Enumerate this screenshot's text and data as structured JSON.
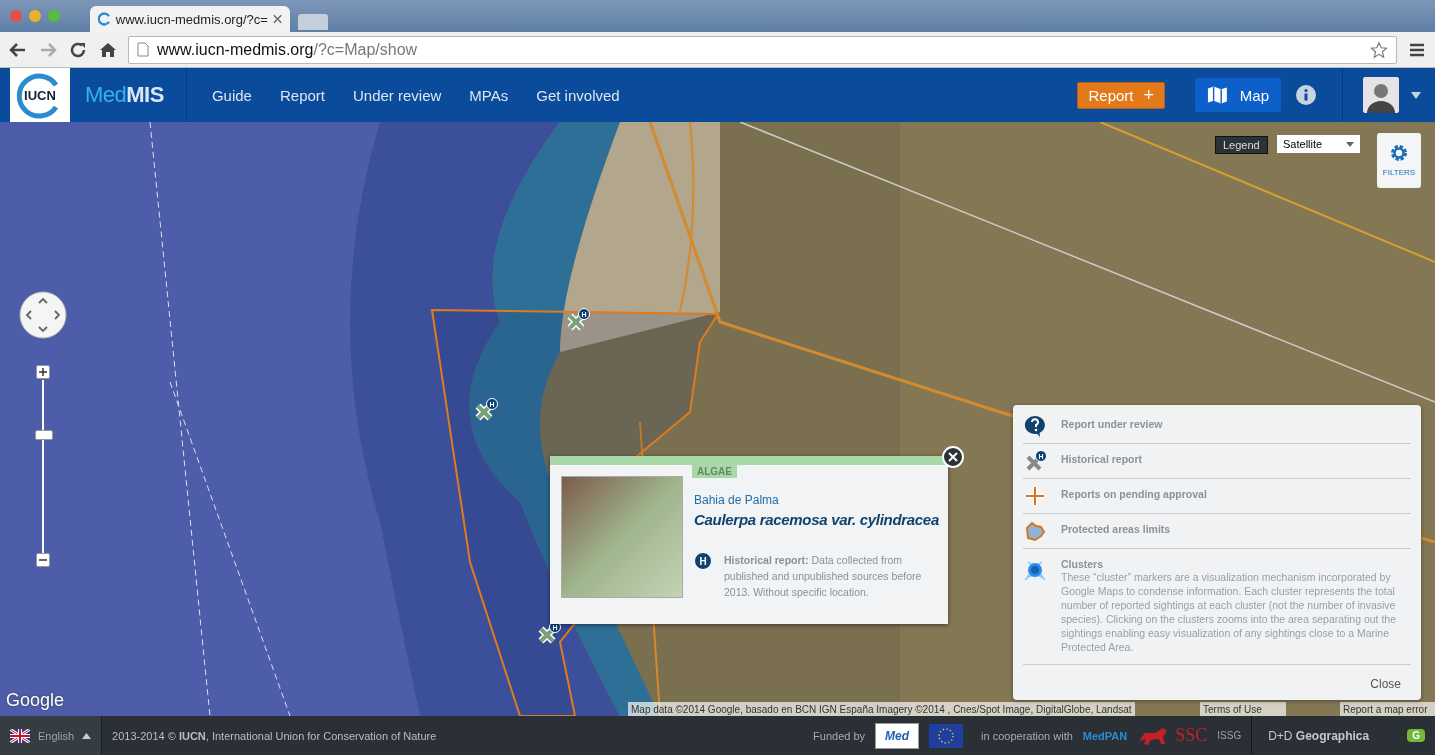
{
  "browser": {
    "tab_title": "www.iucn-medmis.org/?c=",
    "url_host": "www.iucn-medmis.org",
    "url_path": "/?c=Map/show"
  },
  "header": {
    "logo": "IUCN",
    "brand": "Med**MIS**",
    "nav": [
      {
        "label": "Guide"
      },
      {
        "label": "Report"
      },
      {
        "label": "Under review"
      },
      {
        "label": "MPAs"
      },
      {
        "label": "Get involved"
      }
    ],
    "report_button": "Report",
    "report_plus": "+",
    "map_button": "Map"
  },
  "map": {
    "legend_button": "Legend",
    "basemap_select": "Satellite",
    "filters_button": "FILTERS",
    "markers": [
      {
        "badge": "H"
      },
      {
        "badge": "H"
      },
      {
        "badge": "H"
      }
    ],
    "google_logo": "Google",
    "attribution": "Map data ©2014 Google, basado en BCN IGN España Imagery ©2014 , Cnes/Spot Image, DigitalGlobe, Landsat",
    "terms": "Terms of Use",
    "report_error": "Report a map error"
  },
  "popup": {
    "category": "ALGAE",
    "location": "Bahia de Palma",
    "species": "Caulerpa racemosa var. cylindracea",
    "badge": "H",
    "note": "**Historical report:** Data collected from published and unpublished sources before 2013. Without specific location."
  },
  "legend": {
    "items": [
      {
        "kind": "review",
        "label": "Report under review"
      },
      {
        "kind": "historical",
        "label": "Historical report",
        "badge": "H"
      },
      {
        "kind": "pending",
        "label": "Reports on pending approval"
      },
      {
        "kind": "protected",
        "label": "Protected areas limits"
      },
      {
        "kind": "cluster",
        "label": "Clusters",
        "description": "These “cluster” markers are a visualization mechanism incorporated by Google Maps to condense information. Each cluster represents the total number of reported sightings at each cluster (not the number of invasive species). Clicking on the clusters zooms into the area separating out the sightings enabling easy visualization of any sightings close to a Marine Protected Area."
      }
    ],
    "close": "Close"
  },
  "footer": {
    "language": "English",
    "copyright": "2013-2014 © **IUCN**, International Union for Conservation of Nature",
    "funded_by": "Funded by",
    "med_logo": "Med",
    "cooperation": "in cooperation with",
    "partners": [
      {
        "kind": "medpan",
        "name": "MedPAN"
      },
      {
        "kind": "ssc",
        "name": "SSC"
      },
      {
        "kind": "issg",
        "name": "ISSG"
      }
    ],
    "credit": "D+D **Geographica**",
    "credit_badge": "G"
  }
}
